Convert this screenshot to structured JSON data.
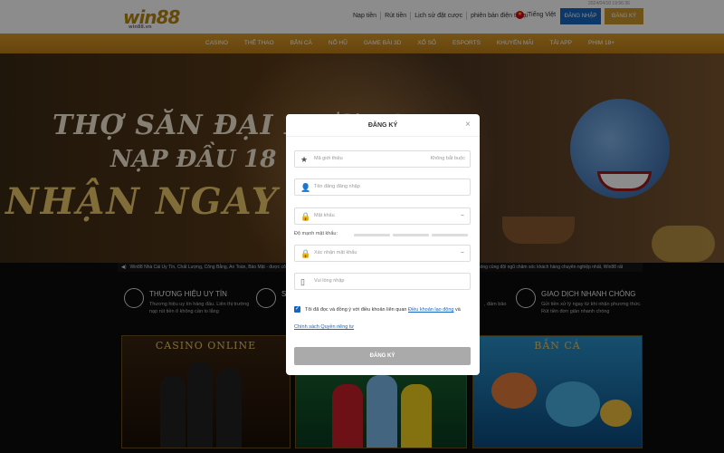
{
  "header": {
    "logo": "win88",
    "logo_sub": "win88.vn",
    "datetime": "2024/04/18 19:56:36",
    "links": [
      "Nạp tiền",
      "Rút tiền",
      "Lịch sử đặt cược",
      "phiên bản điện thoại"
    ],
    "language": "Tiếng Việt",
    "login_label": "ĐĂNG NHẬP",
    "register_label": "ĐĂNG KÝ"
  },
  "nav": {
    "items": [
      "CASINO",
      "THỂ THAO",
      "BẮN CÁ",
      "NỔ HŨ",
      "GAME BÀI 3D",
      "XỔ SỐ",
      "ESPORTS",
      "KHUYẾN MÃI",
      "TẢI APP",
      "PHIM 18+"
    ]
  },
  "banner": {
    "line1": "THỢ SĂN ĐẠI DƯƠNG",
    "line2": "NẠP ĐẦU 18",
    "line3": "NHẬN NGAY"
  },
  "marquee": {
    "left": "Win88 Nhà Cái Uy Tín, Chất Lượng, Công Bằng, An Toàn, Bảo Mật - được côn",
    "right": "nhanh chóng cùng đội ngũ chăm sóc khách hàng chuyên nghiệp nhất, Win88 rất"
  },
  "features": [
    {
      "title": "THƯƠNG HIỆU UY TÍN",
      "desc": "Thương hiệu uy tín hàng đầu. Liên thị trường nạp rút tiền ổ không cần lo lắng"
    },
    {
      "title": "GIAO DỊCH NHANH CHÓNG",
      "desc": "Gửi tiền xử lý ngay từ khi nhận phương thức. Rút tiền đơn giản nhanh chóng"
    }
  ],
  "feature_partial": {
    "title": "S",
    "desc_right": ", đảm bảo"
  },
  "cards": {
    "casino": "CASINO ONLINE",
    "fish": "BẮN CÁ"
  },
  "modal": {
    "title": "ĐĂNG KÝ",
    "close": "×",
    "referral_placeholder": "Mã giới thiệu",
    "referral_hint": "Không bắt buộc",
    "username_placeholder": "Tên đăng đăng nhập",
    "password_placeholder": "Mật khẩu",
    "strength_label": "Độ mạnh mật khẩu:",
    "confirm_placeholder": "Xác nhận mật khẩu",
    "phone_placeholder": "Vui lòng nhập",
    "agree_text": "Tôi đã đọc và đồng ý với điều khoản liên quan",
    "terms_link": "Điều khoản lạo động",
    "agree_and": "và",
    "policy_link": "Chính sách Quyền riêng tư",
    "submit_label": "ĐĂNG KÝ"
  },
  "icons": {
    "referral": "star-icon",
    "username": "user-icon",
    "password": "lock-icon",
    "confirm": "lock-icon",
    "phone": "phone-icon",
    "eye": "eye-icon"
  },
  "colors": {
    "brand_gold": "#c8962c",
    "login_blue": "#1565c0",
    "nav_gold": "#d99a2b",
    "submit_gray": "#aaaaaa"
  }
}
